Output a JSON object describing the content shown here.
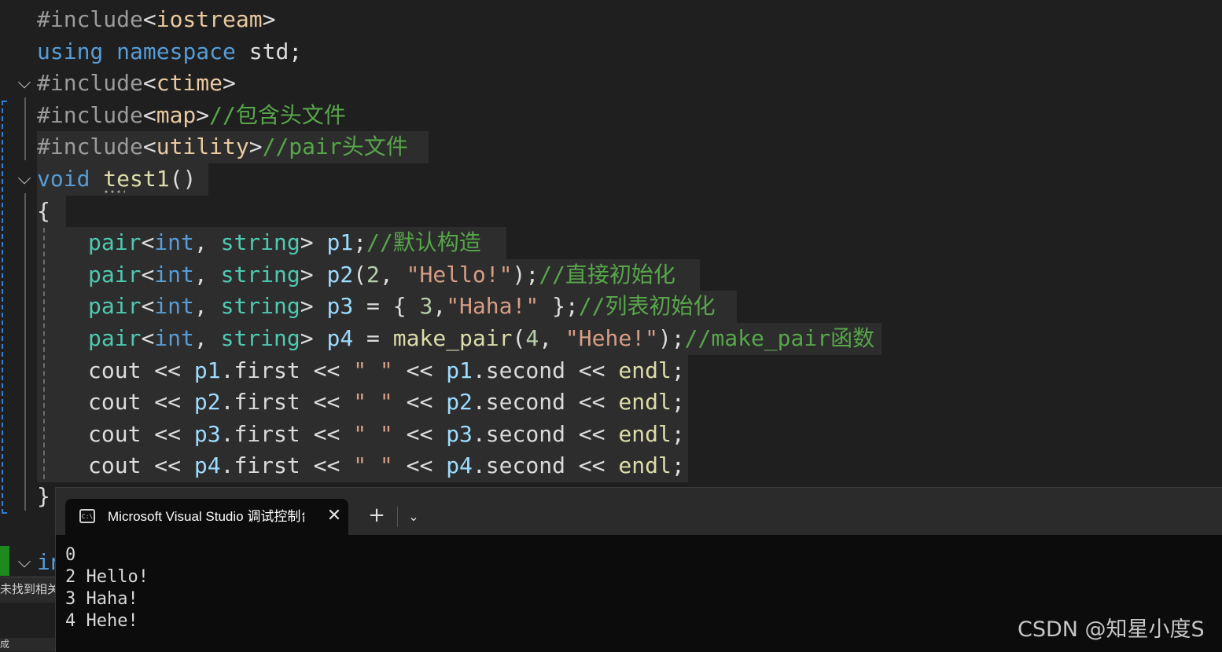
{
  "editor": {
    "lines": {
      "l1": {
        "pp": "#include",
        "lt": "<",
        "header": "iostream",
        "gt": ">"
      },
      "l2": {
        "kw1": "using",
        "kw2": "namespace",
        "rest": " std;"
      },
      "l3": {
        "pp": "#include",
        "lt": "<",
        "header": "ctime",
        "gt": ">"
      },
      "l4": {
        "pp": "#include",
        "lt": "<",
        "header": "map",
        "gt": ">",
        "comment": "//包含头文件"
      },
      "l5": {
        "pp": "#include",
        "lt": "<",
        "header": "utility",
        "gt": ">",
        "comment": "//pair头文件"
      },
      "l6": {
        "kw": "void",
        "fn": "test1",
        "paren": "()"
      },
      "l7": {
        "text": "{"
      },
      "l8": {
        "ty": "pair",
        "a": "<",
        "t1": "int",
        "c": ",",
        "t2": "string",
        "b": ">",
        "var": "p1",
        "semi": ";",
        "comment": "//默认构造"
      },
      "l9": {
        "ty": "pair",
        "a": "<",
        "t1": "int",
        "c": ",",
        "t2": "string",
        "b": ">",
        "var": "p2",
        "open": "(",
        "num": "2",
        "comma": ",",
        "str": "\"Hello!\"",
        "close": ");",
        "comment": "//直接初始化"
      },
      "l10": {
        "ty": "pair",
        "a": "<",
        "t1": "int",
        "c": ",",
        "t2": "string",
        "b": ">",
        "var": "p3",
        "eq": " = { ",
        "num": "3",
        "comma": ",",
        "str": "\"Haha!\"",
        "close": " };",
        "comment": "//列表初始化"
      },
      "l11": {
        "ty": "pair",
        "a": "<",
        "t1": "int",
        "c": ",",
        "t2": "string",
        "b": ">",
        "var": "p4",
        "eq": " = ",
        "fn": "make_pair",
        "open": "(",
        "num": "4",
        "comma": ",",
        "str": "\"Hehe!\"",
        "close": ");",
        "comment": "//make_pair函数"
      },
      "l12": {
        "cout": "cout",
        "op": " << ",
        "var": "p1",
        "first": ".first",
        "sp": "\" \"",
        "second": ".second",
        "endl": "endl",
        "semi": ";"
      },
      "l13": {
        "cout": "cout",
        "op": " << ",
        "var": "p2",
        "first": ".first",
        "sp": "\" \"",
        "second": ".second",
        "endl": "endl",
        "semi": ";"
      },
      "l14": {
        "cout": "cout",
        "op": " << ",
        "var": "p3",
        "first": ".first",
        "sp": "\" \"",
        "second": ".second",
        "endl": "endl",
        "semi": ";"
      },
      "l15": {
        "cout": "cout",
        "op": " << ",
        "var": "p4",
        "first": ".first",
        "sp": "\" \"",
        "second": ".second",
        "endl": "endl",
        "semi": ";"
      },
      "l16": {
        "text": "}"
      },
      "l18": {
        "partial": "in"
      }
    }
  },
  "console": {
    "tab_title": "Microsoft Visual Studio 调试控制台",
    "tab_icon_text": "C:\\",
    "close_glyph": "✕",
    "new_tab_glyph": "+",
    "dropdown_glyph": "⌄",
    "output": [
      "0",
      "2 Hello!",
      "3 Haha!",
      "4 Hehe!"
    ]
  },
  "status": {
    "find_text": "未找到相关问题",
    "bottom_text": "成"
  },
  "watermark": "CSDN @知星小度S",
  "colors": {
    "keyword": "#569cd6",
    "type": "#4ec9b0",
    "string": "#d69d85",
    "comment": "#57a64a",
    "variable": "#9cdcfe",
    "function": "#dcdcaa",
    "console_bg": "#0c0c0c",
    "editor_bg": "#1f1f1f"
  }
}
